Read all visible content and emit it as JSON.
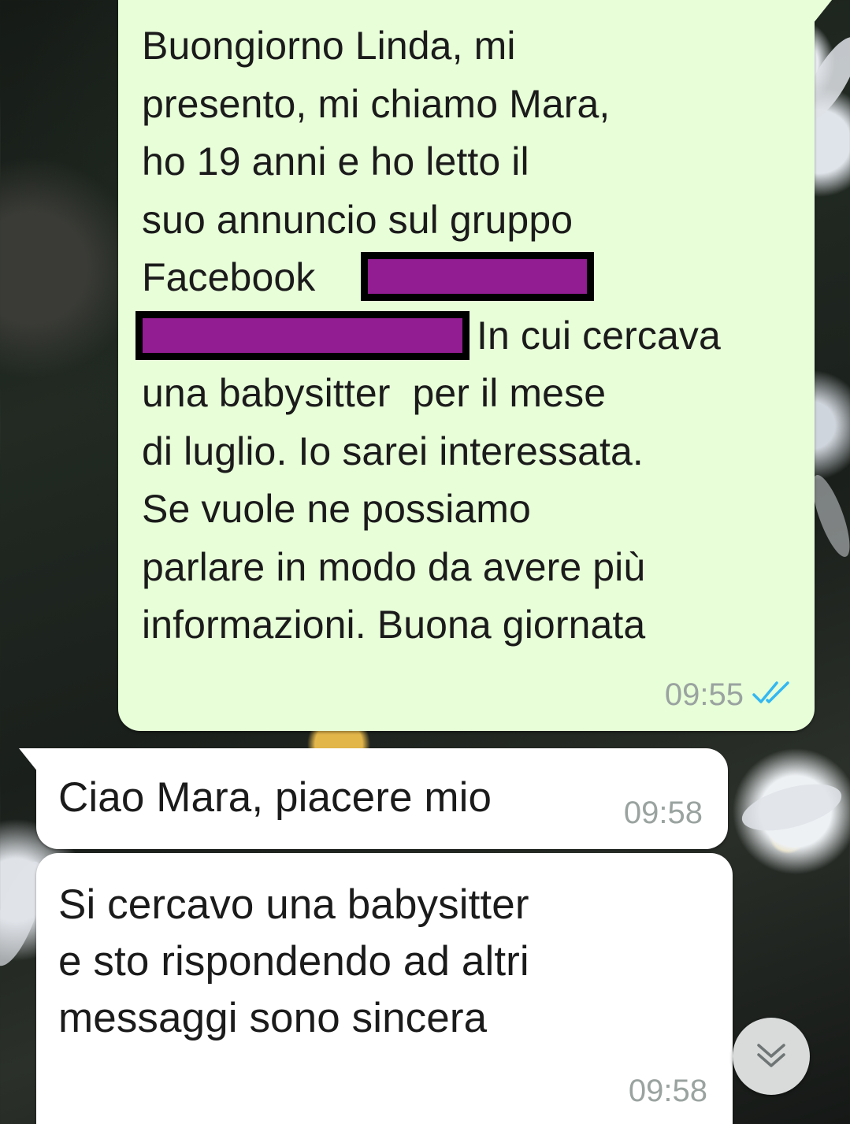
{
  "messages": [
    {
      "direction": "outgoing",
      "lines": [
        "Buongiorno Linda, mi",
        "presento, mi chiamo Mara,",
        "ho 19 anni e ho letto il",
        "suo annuncio sul gruppo",
        "Facebook",
        "In cui cercava",
        "una babysitter  per il mese",
        "di luglio. Io sarei interessata.",
        "Se vuole ne possiamo",
        "parlare in modo da avere più",
        "informazioni. Buona giornata"
      ],
      "time": "09:55",
      "status": "read",
      "status_icon": "double-check-icon",
      "status_color": "#34b7f1"
    },
    {
      "direction": "incoming",
      "text": "Ciao Mara, piacere mio",
      "time": "09:58"
    },
    {
      "direction": "incoming",
      "lines": [
        "Si cercavo una babysitter",
        "e sto rispondendo ad altri",
        "messaggi sono sincera"
      ],
      "time": "09:58"
    }
  ],
  "redaction_color": "#921c92",
  "scroll_button": {
    "icon": "double-chevron-down-icon"
  },
  "colors": {
    "outgoing_bubble": "#e7fed8",
    "incoming_bubble": "#ffffff",
    "time_text": "#9aa3a0"
  }
}
